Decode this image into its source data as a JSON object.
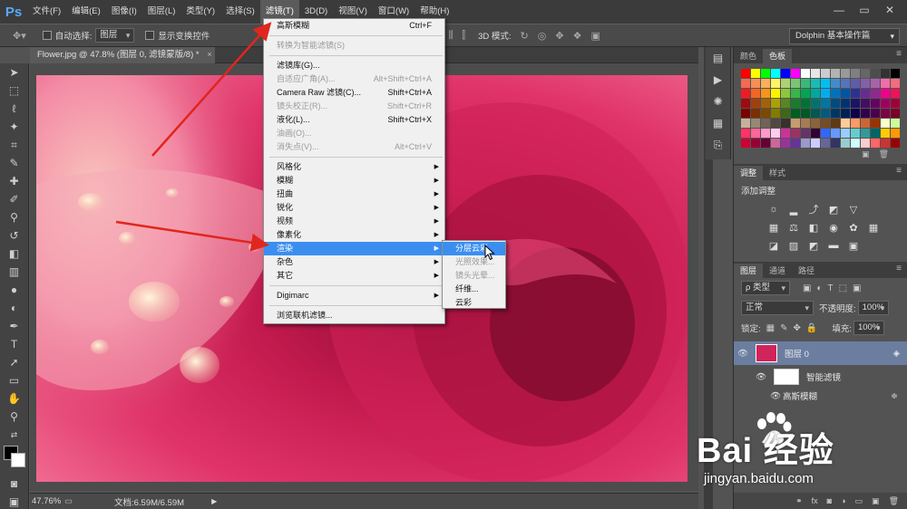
{
  "app": {
    "logo": "Ps"
  },
  "menubar": {
    "items": [
      "文件(F)",
      "编辑(E)",
      "图像(I)",
      "图层(L)",
      "类型(Y)",
      "选择(S)",
      "滤镜(T)",
      "3D(D)",
      "视图(V)",
      "窗口(W)",
      "帮助(H)"
    ],
    "active_index": 6
  },
  "options": {
    "auto_select": "自动选择:",
    "auto_select_value": "图层",
    "show_transform": "显示变换控件",
    "mode3d": "3D 模式:",
    "workspace": "Dolphin 基本操作篇"
  },
  "document": {
    "tab": "Flower.jpg @ 47.8% (图层 0, 滤镜蒙版/8) *",
    "close": "×"
  },
  "status": {
    "zoom": "47.76%",
    "doc": "文档:6.59M/6.59M"
  },
  "filter_menu": {
    "items": [
      {
        "label": "高斯模糊",
        "shortcut": "Ctrl+F",
        "state": "enabled"
      },
      {
        "sep": true
      },
      {
        "label": "转换为智能滤镜(S)",
        "shortcut": "",
        "state": "disabled"
      },
      {
        "sep": true
      },
      {
        "label": "滤镜库(G)...",
        "shortcut": "",
        "state": "enabled"
      },
      {
        "label": "自适应广角(A)...",
        "shortcut": "Alt+Shift+Ctrl+A",
        "state": "disabled"
      },
      {
        "label": "Camera Raw 滤镜(C)...",
        "shortcut": "Shift+Ctrl+A",
        "state": "enabled"
      },
      {
        "label": "镜头校正(R)...",
        "shortcut": "Shift+Ctrl+R",
        "state": "disabled"
      },
      {
        "label": "液化(L)...",
        "shortcut": "Shift+Ctrl+X",
        "state": "enabled"
      },
      {
        "label": "油画(O)...",
        "shortcut": "",
        "state": "disabled"
      },
      {
        "label": "消失点(V)...",
        "shortcut": "Alt+Ctrl+V",
        "state": "disabled"
      },
      {
        "sep": true
      },
      {
        "label": "风格化",
        "submenu": true,
        "state": "enabled"
      },
      {
        "label": "模糊",
        "submenu": true,
        "state": "enabled"
      },
      {
        "label": "扭曲",
        "submenu": true,
        "state": "enabled"
      },
      {
        "label": "锐化",
        "submenu": true,
        "state": "enabled"
      },
      {
        "label": "视频",
        "submenu": true,
        "state": "enabled"
      },
      {
        "label": "像素化",
        "submenu": true,
        "state": "enabled"
      },
      {
        "label": "渲染",
        "submenu": true,
        "state": "highlighted"
      },
      {
        "label": "杂色",
        "submenu": true,
        "state": "enabled"
      },
      {
        "label": "其它",
        "submenu": true,
        "state": "enabled"
      },
      {
        "sep": true
      },
      {
        "label": "Digimarc",
        "submenu": true,
        "state": "enabled"
      },
      {
        "sep": true
      },
      {
        "label": "浏览联机滤镜...",
        "state": "enabled"
      }
    ]
  },
  "render_submenu": {
    "items": [
      {
        "label": "分层云彩",
        "state": "highlighted"
      },
      {
        "label": "光照效果...",
        "state": "disabled"
      },
      {
        "label": "镜头光晕...",
        "state": "disabled"
      },
      {
        "label": "纤维...",
        "state": "enabled"
      },
      {
        "label": "云彩",
        "state": "enabled"
      }
    ]
  },
  "swatches_panel": {
    "tabs": [
      "颜色",
      "色板"
    ],
    "active": 1
  },
  "adjustments_panel": {
    "tabs": [
      "调整",
      "样式"
    ],
    "title": "添加调整"
  },
  "layers_panel": {
    "tabs": [
      "图层",
      "通道",
      "路径"
    ],
    "filter_type": "ρ 类型",
    "blend_mode": "正常",
    "opacity_label": "不透明度:",
    "opacity_value": "100%",
    "lock_label": "锁定:",
    "fill_label": "填充:",
    "fill_value": "100%",
    "layers": [
      {
        "name": "图层 0"
      },
      {
        "name": "智能滤镜"
      },
      {
        "name": "高斯模糊"
      }
    ]
  },
  "watermark": {
    "brand": "Bai 经验",
    "url": "jingyan.baidu.com"
  },
  "colors": {
    "menu_highlight": "#3b8ef0",
    "arrow": "#e0261e",
    "canvas_pink": "#d0245a"
  }
}
